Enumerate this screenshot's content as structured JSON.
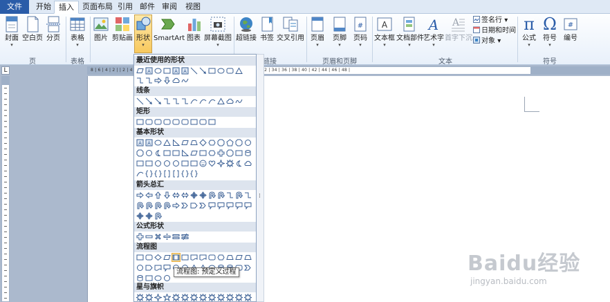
{
  "tabs": {
    "file": "文件",
    "items": [
      "开始",
      "插入",
      "页面布局",
      "引用",
      "邮件",
      "审阅",
      "视图"
    ],
    "active": "插入"
  },
  "ribbon": {
    "pages_group": {
      "cover": "封面",
      "blank": "空白页",
      "break": "分页",
      "label": "页"
    },
    "tables_group": {
      "table": "表格",
      "label": "表格"
    },
    "illustrations_group": {
      "picture": "图片",
      "clipart": "剪贴画",
      "shapes": "形状",
      "smartart": "SmartArt",
      "chart": "图表",
      "screenshot": "屏幕截图"
    },
    "links_group": {
      "hyperlink": "超链接",
      "bookmark": "书签",
      "crossref": "交叉引用",
      "label": "链接"
    },
    "header_footer_group": {
      "header": "页眉",
      "footer": "页脚",
      "page_number": "页码",
      "label": "页眉和页脚"
    },
    "text_group": {
      "textbox": "文本框",
      "quickparts": "文档部件",
      "wordart": "艺术字",
      "dropcap": "首字下沉",
      "signature": "签名行",
      "datetime": "日期和时间",
      "object": "对象",
      "label": "文本"
    },
    "symbols_group": {
      "equation": "公式",
      "symbol": "符号",
      "number": "编号",
      "label": "符号"
    }
  },
  "ruler": {
    "numbers": "8 | 6 | 4 | 2 | | 2 | 4 | 6 | 8 | 10 | 12 | 14 | 16 | 18 | 20 | 22 | 24 | 26 | 28 | 30 | 32 | 34 | 36 | 38 | 40 | 42 | 44 | 46 | 48 |",
    "corner": "L"
  },
  "shapes_menu": {
    "categories": [
      "最近使用的形状",
      "线条",
      "矩形",
      "基本形状",
      "箭头总汇",
      "公式形状",
      "流程图",
      "星与旗帜"
    ],
    "tooltip": "流程图: 预定义过程"
  },
  "watermark": {
    "brand": "Baidu经验",
    "url": "jingyan.baidu.com"
  },
  "colors": {
    "accent": "#2a5ca8",
    "ribbon_bg": "#e8f0fa",
    "doc_bg": "#abb9cd",
    "highlight": "#fde8a8"
  }
}
